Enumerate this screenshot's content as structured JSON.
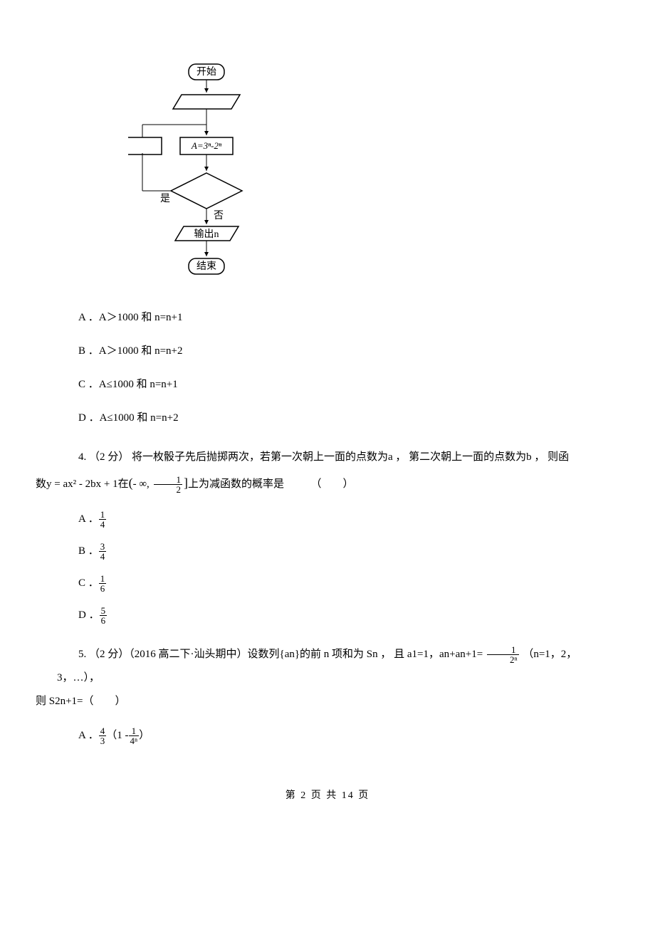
{
  "flowchart": {
    "start": "开始",
    "process": "A=3ⁿ-2ⁿ",
    "yes": "是",
    "no": "否",
    "output": "输出n",
    "end": "结束"
  },
  "q3": {
    "optA": "A ．A＞1000 和 n=n+1",
    "optB": "B ．A＞1000 和 n=n+2",
    "optC": "C ．A≤1000 和 n=n+1",
    "optD": "D ．A≤1000 和 n=n+2"
  },
  "q4": {
    "stem_p1": "4. （2 分） 将一枚骰子先后抛掷两次，若第一次朝上一面的点数为a ， 第二次朝上一面的点数为b ， 则函",
    "stem_p2a": "数y = ax² - 2bx + 1在",
    "interval_left": "- ∞,",
    "interval_num": "1",
    "interval_den": "2",
    "stem_p2b": "上为减函数的概率是　　　（　　）",
    "optA_prefix": "A ．",
    "optA_num": "1",
    "optA_den": "4",
    "optB_prefix": "B ．",
    "optB_num": "3",
    "optB_den": "4",
    "optC_prefix": "C ．",
    "optC_num": "1",
    "optC_den": "6",
    "optD_prefix": "D ．",
    "optD_num": "5",
    "optD_den": "6"
  },
  "q5": {
    "stem_p1a": "5. （2 分）（2016 高二下·汕头期中）设数列{an}的前 n 项和为 Sn ， 且 a1=1，an+an+1= ",
    "frac1_num": "1",
    "frac1_den": "2ⁿ",
    "stem_p1b": " （n=1，2，3，…），",
    "stem_p2": "则 S2n+1=（　　）",
    "optA_prefix": "A ．",
    "optA_num": "4",
    "optA_den": "3",
    "optA_mid": " （1 - ",
    "optA_num2": "1",
    "optA_den2": "4ⁿ",
    "optA_end": " ）"
  },
  "footer": "第 2 页 共 14 页"
}
